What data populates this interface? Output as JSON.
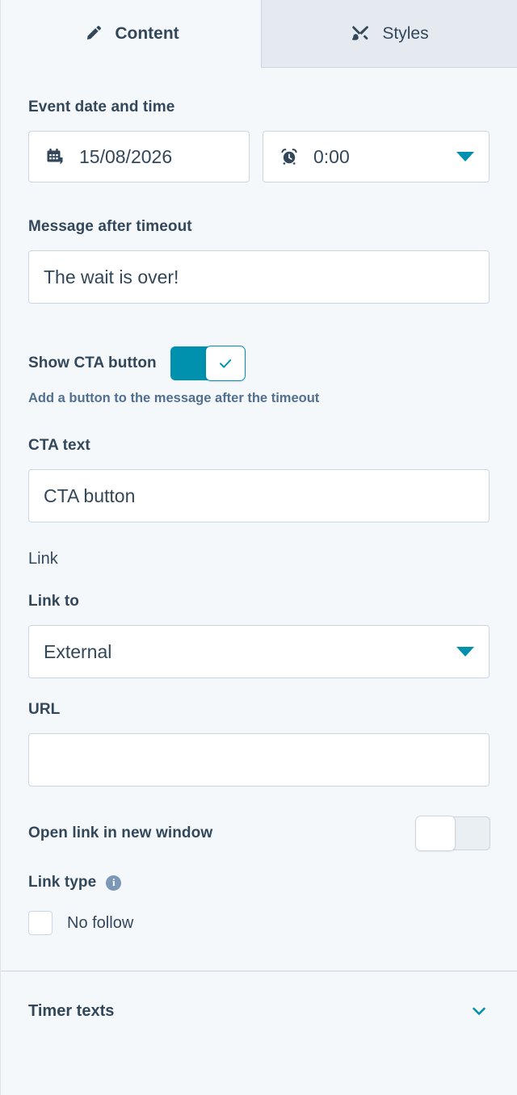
{
  "tabs": [
    {
      "label": "Content",
      "icon": "pencil-icon",
      "active": true
    },
    {
      "label": "Styles",
      "icon": "paintbrush-icon",
      "active": false
    }
  ],
  "form": {
    "event_datetime": {
      "label": "Event date and time",
      "date": {
        "value": "15/08/2026",
        "icon": "calendar-icon"
      },
      "time": {
        "value": "0:00",
        "icon": "alarm-clock-icon",
        "caret": "caret-down-icon"
      }
    },
    "message_after_timeout": {
      "label": "Message after timeout",
      "value": "The wait is over!"
    },
    "show_cta_button": {
      "label": "Show CTA button",
      "state": "on",
      "helper": "Add a button to the message after the timeout",
      "check_icon": "check-icon"
    },
    "cta_text": {
      "label": "CTA text",
      "value": "CTA button"
    },
    "link_section": {
      "heading": "Link",
      "link_to": {
        "label": "Link to",
        "value": "External",
        "caret": "caret-down-icon"
      },
      "url": {
        "label": "URL",
        "value": ""
      },
      "open_new_window": {
        "label": "Open link in new window",
        "state": "off"
      },
      "link_type": {
        "label": "Link type",
        "info_icon": "info-icon",
        "info_glyph": "i",
        "checkbox_label": "No follow",
        "checked": false
      }
    }
  },
  "accordion": {
    "title": "Timer texts",
    "chevron": "chevron-down-icon"
  },
  "colors": {
    "accent": "#0091ae",
    "text": "#33475b",
    "muted_text": "#516f90",
    "border": "#cbd6e2",
    "background": "#f5f8fa",
    "tab_inactive_bg": "#e5eaf0"
  }
}
